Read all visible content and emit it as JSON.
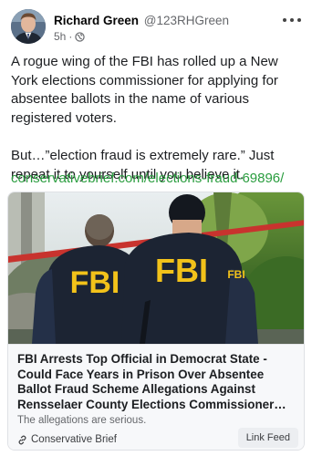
{
  "post": {
    "author_name": "Richard Green",
    "author_handle": "@123RHGreen",
    "time": "5h",
    "separator": "·",
    "body_paragraph_1": "A rogue wing of the FBI has rolled up a New York elections commissioner for applying for absentee ballots in the name of various registered voters.",
    "body_paragraph_2": "But…”election fraud is extremely rare.” Just repeat it to yourself until you believe it.",
    "link_text": "conservativebrief.com/elections-fraud-69896/"
  },
  "card": {
    "image_jacket_text_left": "FBI",
    "image_jacket_text_right": "FBI",
    "image_sleeve_text": "FBI",
    "title": "FBI Arrests Top Official in Democrat State - Could Face Years in Prison Over Absentee Ballot Fraud Scheme Allegations Against Rensselaer County Elections Commissioner…",
    "description": "The allegations are serious.",
    "source": "Conservative Brief",
    "button_label": "Link Feed"
  },
  "icons": {
    "audience": "globe-icon",
    "menu": "more-options-icon",
    "source": "link-icon"
  },
  "colors": {
    "link": "#2a9d3f",
    "fbi_lettering": "#f2c21a",
    "jacket": "#1c2433",
    "tape": "#c8332e"
  }
}
